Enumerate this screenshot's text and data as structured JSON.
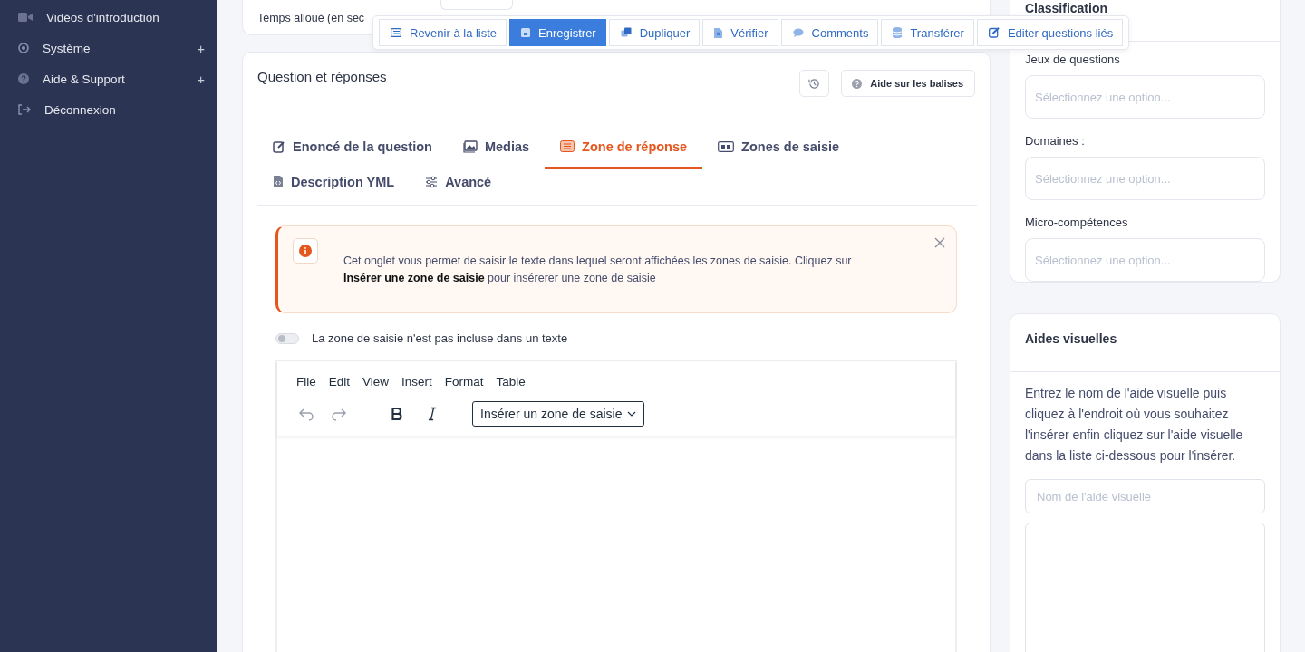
{
  "sidebar": {
    "items": [
      {
        "label": "Vidéos d'introduction",
        "kind": "video"
      },
      {
        "label": "Système",
        "kind": "system",
        "toggle": "+"
      },
      {
        "label": "Aide & Support",
        "kind": "help",
        "toggle": "+"
      },
      {
        "label": "Déconnexion",
        "kind": "logout"
      }
    ]
  },
  "settings_card": {
    "field_label": "Temps alloué (en sec"
  },
  "action_bar": [
    {
      "label": "Revenir à la liste",
      "kind": "back",
      "primary": false
    },
    {
      "label": "Enregistrer",
      "kind": "save",
      "primary": true
    },
    {
      "label": "Dupliquer",
      "kind": "duplicate",
      "primary": false
    },
    {
      "label": "Vérifier",
      "kind": "verify",
      "primary": false
    },
    {
      "label": "Comments",
      "kind": "comment",
      "primary": false
    },
    {
      "label": "Transférer",
      "kind": "transfer",
      "primary": false
    },
    {
      "label": "Editer questions liés",
      "kind": "edit",
      "primary": false
    }
  ],
  "question_card": {
    "title": "Question et réponses",
    "help_button": "Aide sur les balises",
    "tabs": [
      {
        "label": "Enoncé de la question",
        "kind": "statement",
        "selected": false
      },
      {
        "label": "Medias",
        "kind": "media",
        "selected": false
      },
      {
        "label": "Zone de réponse",
        "kind": "answer",
        "selected": true
      },
      {
        "label": "Zones de saisie",
        "kind": "inputs",
        "selected": false
      },
      {
        "label": "Description YML",
        "kind": "yml",
        "selected": false
      },
      {
        "label": "Avancé",
        "kind": "advanced",
        "selected": false
      }
    ],
    "alert": {
      "text": "Cet onglet vous permet de saisir le texte dans lequel seront affichées les zones de saisie. Cliquez sur **Insérer une zone de saisie** pour insérerer une zone de saisie"
    },
    "toggle": {
      "label": "La zone de saisie n'est pas incluse dans un texte",
      "on": false
    },
    "editor": {
      "menu": [
        "File",
        "Edit",
        "View",
        "Insert",
        "Format",
        "Table"
      ],
      "format_dropdown": "Insérer un zone de saisie"
    }
  },
  "classification": {
    "title": "Classification",
    "fields": [
      {
        "label": "Jeux de questions",
        "placeholder": "Sélectionnez une option..."
      },
      {
        "label": "Domaines :",
        "placeholder": "Sélectionnez une option..."
      },
      {
        "label": "Micro-compétences",
        "placeholder": "Sélectionnez une option..."
      }
    ]
  },
  "visual_aids": {
    "title": "Aides visuelles",
    "description": "Entrez le nom de l'aide visuelle puis cliquez à l'endroit où vous souhaitez l'insérer enfin cliquez sur l'aide visuelle dans la liste ci-dessous pour l'insérer.",
    "name_field": {
      "placeholder": "Nom de l'aide visuelle"
    }
  }
}
